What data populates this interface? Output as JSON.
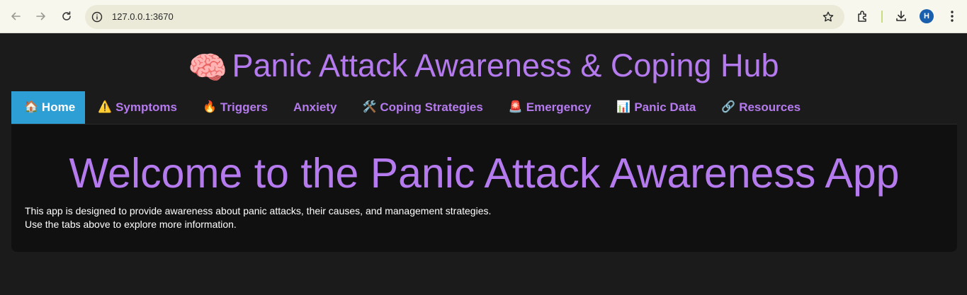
{
  "browser": {
    "url": "127.0.0.1:3670",
    "profile_initial": "H",
    "icons": [
      "back-icon",
      "forward-icon",
      "reload-icon",
      "site-info-icon",
      "bookmark-star-icon",
      "extensions-icon",
      "download-icon",
      "more-icon"
    ]
  },
  "app": {
    "title_emoji": "🧠",
    "title": "Panic Attack Awareness & Coping Hub",
    "tabs": [
      {
        "icon": "🏠",
        "label": "Home",
        "active": true
      },
      {
        "icon": "⚠️",
        "label": "Symptoms",
        "active": false
      },
      {
        "icon": "🔥",
        "label": "Triggers",
        "active": false
      },
      {
        "icon": "",
        "label": "Anxiety",
        "active": false
      },
      {
        "icon": "🛠️",
        "label": "Coping Strategies",
        "active": false
      },
      {
        "icon": "🚨",
        "label": "Emergency",
        "active": false
      },
      {
        "icon": "📊",
        "label": "Panic Data",
        "active": false
      },
      {
        "icon": "🔗",
        "label": "Resources",
        "active": false
      }
    ],
    "welcome_heading": "Welcome to the Panic Attack Awareness App",
    "description_line1": "This app is designed to provide awareness about panic attacks, their causes, and management strategies.",
    "description_line2": "Use the tabs above to explore more information."
  },
  "colors": {
    "accent_purple": "#b57bee",
    "active_tab_blue": "#2e9fd4",
    "page_background": "#1b1b1b",
    "panel_background": "#101010"
  }
}
